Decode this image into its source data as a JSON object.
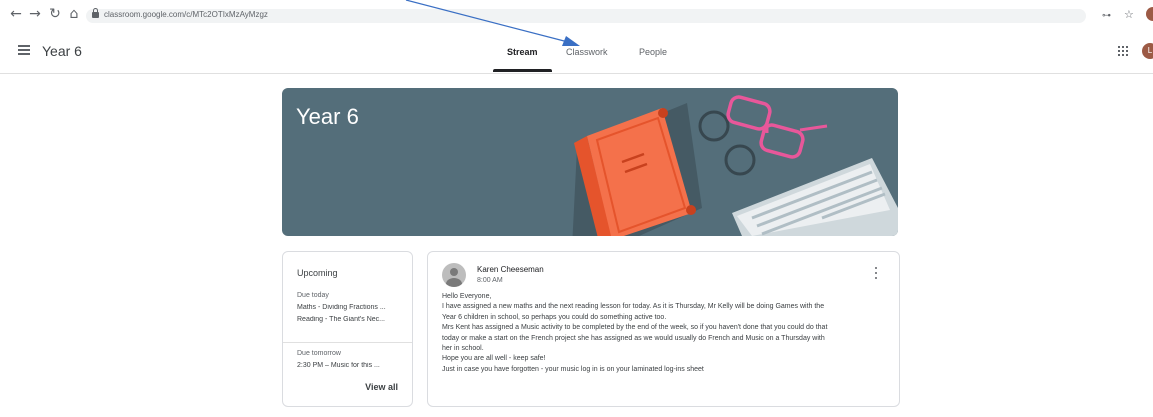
{
  "browser": {
    "nav_icons": [
      "back-arrow",
      "forward-arrow",
      "reload",
      "home"
    ],
    "url": "classroom.google.com/c/MTc2OTIxMzAyMzgz"
  },
  "header": {
    "class_name": "Year 6",
    "tabs": [
      {
        "label": "Stream",
        "active": true
      },
      {
        "label": "Classwork",
        "active": false
      },
      {
        "label": "People",
        "active": false
      }
    ],
    "avatar_initial": "L"
  },
  "banner": {
    "title": "Year 6",
    "background_color": "#546e7a"
  },
  "upcoming": {
    "title": "Upcoming",
    "groups": [
      {
        "label": "Due today",
        "items": [
          "Maths - Dividing Fractions ...",
          "Reading - The Giant's Nec..."
        ]
      },
      {
        "label": "Due tomorrow",
        "items": [
          "2:30 PM – Music for this ..."
        ]
      }
    ],
    "view_all": "View all"
  },
  "post": {
    "author": "Karen Cheeseman",
    "time": "8:00 AM",
    "lines": [
      "Hello Everyone,",
      "I have assigned a new maths and the next reading lesson for today. As it is Thursday, Mr Kelly will be doing Games with the",
      "Year 6 children in school, so perhaps you could do something active too.",
      "Mrs Kent has assigned a Music activity to be completed by the end of the week, so if you haven't done that you could do that",
      "today or make a start on the French project she has assigned as we would usually do French and Music on a Thursday with",
      "her in school.",
      "Hope you are all well - keep safe!",
      "Just in case you have forgotten - your music log in is on your laminated log-ins sheet"
    ]
  },
  "colors": {
    "annotation_arrow": "#3a6fc4",
    "book": "#f4714b",
    "glasses": "#e8579a"
  }
}
